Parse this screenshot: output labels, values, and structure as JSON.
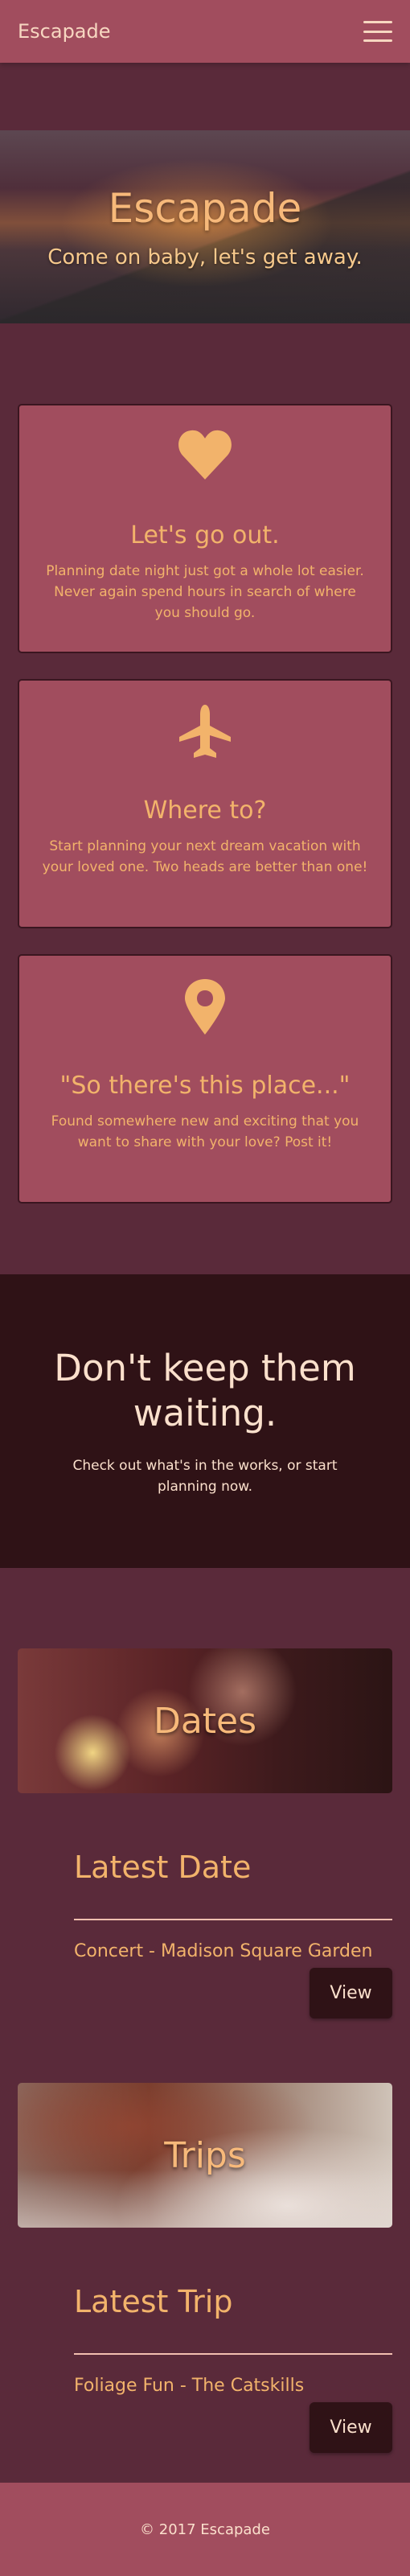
{
  "nav": {
    "brand": "Escapade",
    "menu_icon": "hamburger-menu-icon"
  },
  "hero": {
    "title": "Escapade",
    "subtitle": "Come on baby, let's get away."
  },
  "features": [
    {
      "icon": "heart-icon",
      "title": "Let's go out.",
      "text": "Planning date night just got a whole lot easier. Never again spend hours in search of where you should go."
    },
    {
      "icon": "airplane-icon",
      "title": "Where to?",
      "text": "Start planning your next dream vacation with your loved one. Two heads are better than one!"
    },
    {
      "icon": "map-pin-icon",
      "title": "\"So there's this place...\"",
      "text": "Found somewhere new and exciting that you want to share with your love? Post it!"
    }
  ],
  "cta": {
    "heading": "Don't keep them waiting.",
    "text": "Check out what's in the works, or start planning now."
  },
  "dates": {
    "banner": "Dates",
    "heading": "Latest Date",
    "item": "Concert - Madison Square Garden",
    "button": "View"
  },
  "trips": {
    "banner": "Trips",
    "heading": "Latest Trip",
    "item": "Foliage Fun - The Catskills",
    "button": "View"
  },
  "footer": {
    "text": "© 2017 Escapade"
  },
  "colors": {
    "accent": "#a14d5e",
    "text": "#f2b36b",
    "dark": "#2f1216",
    "background": "#5a2a3a"
  }
}
